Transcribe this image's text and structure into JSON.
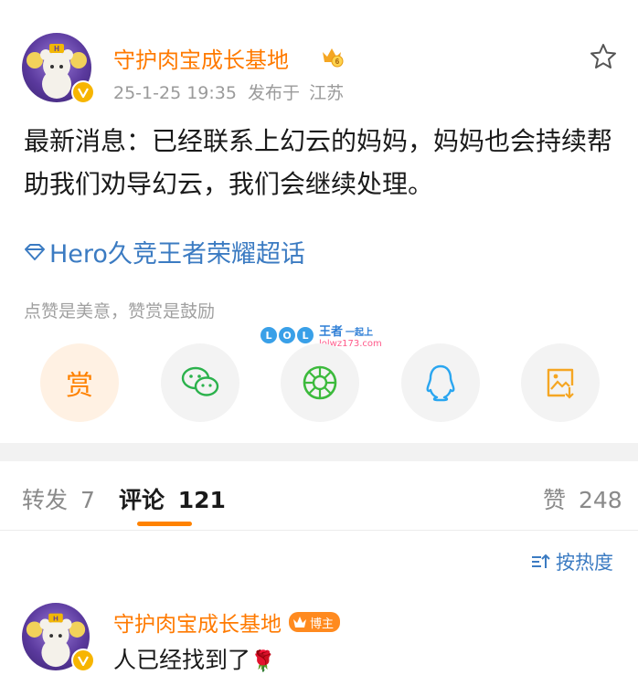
{
  "post": {
    "author": "守护肉宝成长基地",
    "timestamp": "25-1-25 19:35",
    "published_prefix": "发布于",
    "location": "江苏",
    "content": "最新消息：已经联系上幻云的妈妈，妈妈也会持续帮助我们劝导幻云，我们会继续处理。",
    "topic": "Hero久竞王者荣耀超话",
    "reward_hint": "点赞是美意，赞赏是鼓励",
    "level_badge": "6",
    "icons": {
      "favorite": "star-outline-icon",
      "topic": "diamond-icon",
      "verified": "verified-v-icon",
      "vip": "crown-icon"
    }
  },
  "share": {
    "reward_label": "赏",
    "items": [
      "reward",
      "wechat",
      "moments",
      "qq",
      "save-image"
    ]
  },
  "watermark": {
    "lol_letters": [
      "L",
      "O",
      "L"
    ],
    "title": "王者",
    "subtitle": "一起上",
    "url": "lolwz173.com"
  },
  "tabs": {
    "repost_label": "转发",
    "repost_count": "7",
    "comment_label": "评论",
    "comment_count": "121",
    "like_label": "赞",
    "like_count": "248"
  },
  "sort": {
    "label": "按热度",
    "icon": "sort-icon"
  },
  "comments": [
    {
      "author": "守护肉宝成长基地",
      "badge": "博主",
      "text": "人已经找到了",
      "emoji": "🌹"
    }
  ],
  "colors": {
    "accent": "#ff8200",
    "name": "#ff7a00",
    "link": "#3b7bc2",
    "wechat": "#2bb24c",
    "moments": "#3cba3c",
    "qq": "#2aa6f0",
    "save": "#f5a623"
  }
}
